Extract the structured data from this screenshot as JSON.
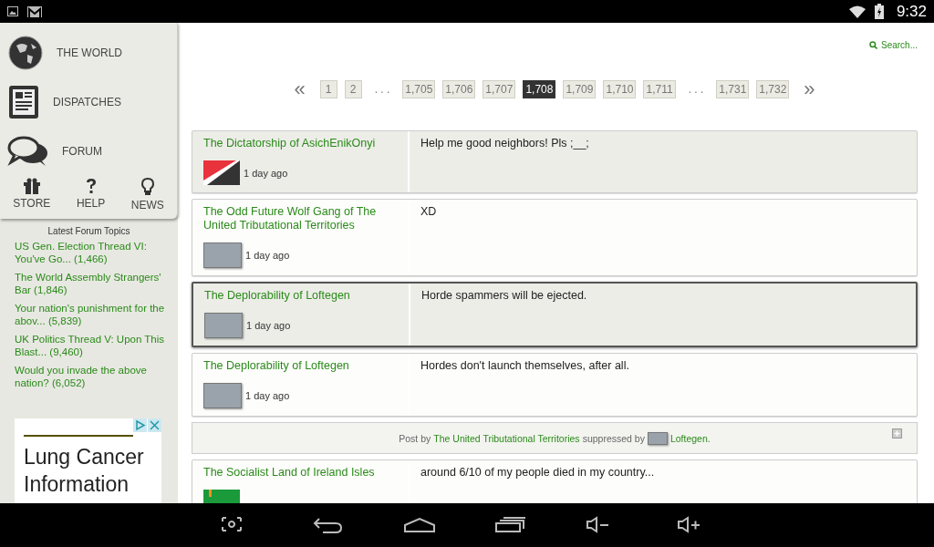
{
  "status_bar": {
    "time": "9:32"
  },
  "sidebar": {
    "nav": [
      {
        "label": "THE WORLD",
        "kind": "world"
      },
      {
        "label": "DISPATCHES",
        "kind": "dispatches"
      },
      {
        "label": "FORUM",
        "kind": "forum"
      }
    ],
    "small_nav": [
      {
        "label": "STORE",
        "kind": "store"
      },
      {
        "label": "HELP",
        "kind": "help"
      },
      {
        "label": "NEWS",
        "kind": "news"
      }
    ],
    "topics_title": "Latest Forum Topics",
    "topics": [
      {
        "title": "US Gen. Election Thread VI: You've Go...",
        "count": "(1,466)"
      },
      {
        "title": "The World Assembly Strangers' Bar",
        "count": "(1,846)"
      },
      {
        "title": "Your nation's punishment for the abov...",
        "count": "(5,839)"
      },
      {
        "title": "UK Politics Thread V: Upon This Blast...",
        "count": "(9,460)"
      },
      {
        "title": "Would you invade the above nation?",
        "count": "(6,052)"
      }
    ],
    "ad": {
      "text": "Lung Cancer Information"
    }
  },
  "search": {
    "placeholder": "Search..."
  },
  "pagination": [
    {
      "label": "«",
      "kind": "prev",
      "selected": false
    },
    {
      "label": "1",
      "kind": "page",
      "selected": false
    },
    {
      "label": "2",
      "kind": "page",
      "selected": false
    },
    {
      "label": ". . .",
      "kind": "gap",
      "selected": false
    },
    {
      "label": "1,705",
      "kind": "page",
      "selected": false
    },
    {
      "label": "1,706",
      "kind": "page",
      "selected": false
    },
    {
      "label": "1,707",
      "kind": "page",
      "selected": false
    },
    {
      "label": "1,708",
      "kind": "page",
      "selected": true
    },
    {
      "label": "1,709",
      "kind": "page",
      "selected": false
    },
    {
      "label": "1,710",
      "kind": "page",
      "selected": false
    },
    {
      "label": "1,711",
      "kind": "page",
      "selected": false
    },
    {
      "label": ". . .",
      "kind": "gap",
      "selected": false
    },
    {
      "label": "1,731",
      "kind": "page",
      "selected": false
    },
    {
      "label": "1,732",
      "kind": "page",
      "selected": false
    },
    {
      "label": "»",
      "kind": "next",
      "selected": false
    }
  ],
  "posts": [
    {
      "kind": "post",
      "author": "The Dictatorship of AsichEnikOnyi",
      "avatar": {
        "kind": "flag-diagonal"
      },
      "time": "1 day ago",
      "message": "Help me good neighbors! Pls ;__;",
      "shaded": true,
      "selected": false
    },
    {
      "kind": "post",
      "author": "The Odd Future Wolf Gang of The United Tributational Territories",
      "avatar": {
        "kind": "photo"
      },
      "time": "1 day ago",
      "message": "XD",
      "shaded": false,
      "selected": false
    },
    {
      "kind": "post",
      "author": "The Deplorability of Loftegen",
      "avatar": {
        "kind": "photo"
      },
      "time": "1 day ago",
      "message": "Horde spammers will be ejected.",
      "shaded": true,
      "selected": true
    },
    {
      "kind": "post",
      "author": "The Deplorability of Loftegen",
      "avatar": {
        "kind": "photo"
      },
      "time": "1 day ago",
      "message": "Hordes don't launch themselves, after all.",
      "shaded": false,
      "selected": false
    },
    {
      "kind": "suppressed",
      "prefix": "Post by",
      "author": "The United Tributational Territories",
      "middle": "suppressed by",
      "moderator": "Loftegen",
      "suffix": "."
    },
    {
      "kind": "post",
      "author": "The Socialist Land of Ireland Isles",
      "avatar": {
        "kind": "flag-green"
      },
      "message": "around 6/10 of my people died in my country...",
      "shaded": false,
      "selected": false
    }
  ]
}
